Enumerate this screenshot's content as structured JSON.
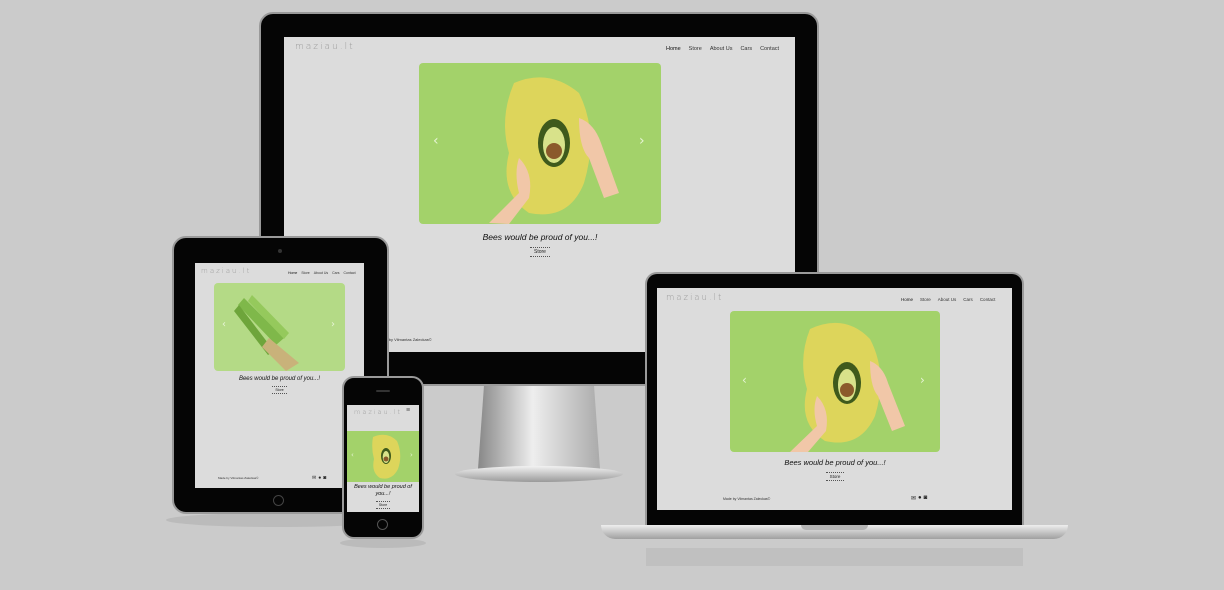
{
  "site": {
    "logo": "maziau.lt",
    "nav": [
      "Home",
      "Store",
      "About Us",
      "Cars",
      "Contact"
    ],
    "tagline": "Bees would be proud of you...!",
    "store_button": "Store",
    "footer": "Made by Vilmantas Zaleckas©"
  },
  "devices": {
    "desktop": {
      "nav": [
        "Home",
        "Store",
        "About Us",
        "Cars",
        "Contact"
      ],
      "footer_partial": "ade by Vilmantas Zaleckas©"
    },
    "tablet": {
      "nav": [
        "Home",
        "Store",
        "About Us",
        "Cars",
        "Contact"
      ]
    },
    "laptop": {
      "nav": [
        "Home",
        "Store",
        "About Us",
        "Cars",
        "Contact"
      ]
    },
    "phone": {
      "tagline_line1": "Bees would be proud of",
      "tagline_line2": "you...!"
    }
  },
  "icons": {
    "carousel_prev": "‹",
    "carousel_next": "›",
    "hamburger": "≡",
    "social": [
      "mail-icon",
      "facebook-icon",
      "instagram-icon"
    ]
  },
  "colors": {
    "background": "#cbcbcb",
    "screen": "#dcdcdc",
    "hero_green": "#a3d26a",
    "bezel": "#050505"
  }
}
